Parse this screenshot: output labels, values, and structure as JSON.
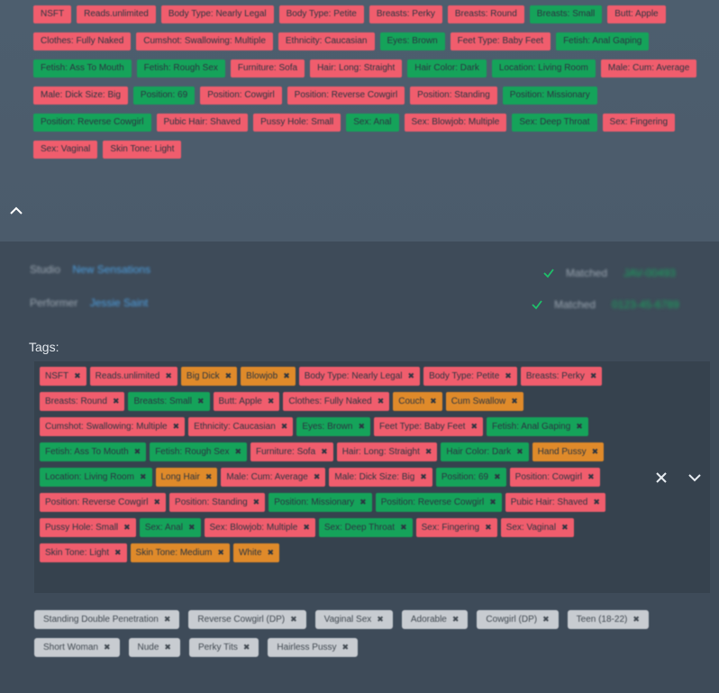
{
  "top_tags": [
    {
      "text": "NSFT",
      "color": "red"
    },
    {
      "text": "Reads.unlimited",
      "color": "red"
    },
    {
      "text": "Body Type: Nearly Legal",
      "color": "red"
    },
    {
      "text": "Body Type: Petite",
      "color": "red"
    },
    {
      "text": "Breasts: Perky",
      "color": "red"
    },
    {
      "text": "Breasts: Round",
      "color": "red"
    },
    {
      "text": "Breasts: Small",
      "color": "green"
    },
    {
      "text": "Butt: Apple",
      "color": "red"
    },
    {
      "text": "Clothes: Fully Naked",
      "color": "red"
    },
    {
      "text": "Cumshot: Swallowing: Multiple",
      "color": "red"
    },
    {
      "text": "Ethnicity: Caucasian",
      "color": "red"
    },
    {
      "text": "Eyes: Brown",
      "color": "green"
    },
    {
      "text": "Feet Type: Baby Feet",
      "color": "red"
    },
    {
      "text": "Fetish: Anal Gaping",
      "color": "green"
    },
    {
      "text": "Fetish: Ass To Mouth",
      "color": "green"
    },
    {
      "text": "Fetish: Rough Sex",
      "color": "green"
    },
    {
      "text": "Furniture: Sofa",
      "color": "red"
    },
    {
      "text": "Hair: Long: Straight",
      "color": "red"
    },
    {
      "text": "Hair Color: Dark",
      "color": "green"
    },
    {
      "text": "Location: Living Room",
      "color": "green"
    },
    {
      "text": "Male: Cum: Average",
      "color": "red"
    },
    {
      "text": "Male: Dick Size: Big",
      "color": "red"
    },
    {
      "text": "Position: 69",
      "color": "green"
    },
    {
      "text": "Position: Cowgirl",
      "color": "red"
    },
    {
      "text": "Position: Reverse Cowgirl",
      "color": "red"
    },
    {
      "text": "Position: Standing",
      "color": "red"
    },
    {
      "text": "Position: Missionary",
      "color": "green"
    },
    {
      "text": "Position: Reverse Cowgirl",
      "color": "green"
    },
    {
      "text": "Pubic Hair: Shaved",
      "color": "red"
    },
    {
      "text": "Pussy Hole: Small",
      "color": "red"
    },
    {
      "text": "Sex: Anal",
      "color": "green"
    },
    {
      "text": "Sex: Blowjob: Multiple",
      "color": "red"
    },
    {
      "text": "Sex: Deep Throat",
      "color": "green"
    },
    {
      "text": "Sex: Fingering",
      "color": "red"
    },
    {
      "text": "Sex: Vaginal",
      "color": "red"
    },
    {
      "text": "Skin Tone: Light",
      "color": "red"
    }
  ],
  "info": {
    "studio_key": "Studio",
    "studio_val": "New Sensations",
    "performer_key": "Performer",
    "performer_val": "Jessie Saint"
  },
  "status": [
    {
      "label": "Matched",
      "value": "JAV-00493"
    },
    {
      "label": "Matched",
      "value": "0123-45-6789"
    }
  ],
  "tags_label": "Tags:",
  "box_tags": [
    {
      "text": "NSFT",
      "color": "red"
    },
    {
      "text": "Reads.unlimited",
      "color": "red"
    },
    {
      "text": "Big Dick",
      "color": "orange"
    },
    {
      "text": "Blowjob",
      "color": "orange"
    },
    {
      "text": "Body Type: Nearly Legal",
      "color": "red"
    },
    {
      "text": "Body Type: Petite",
      "color": "red"
    },
    {
      "text": "Breasts: Perky",
      "color": "red"
    },
    {
      "text": "Breasts: Round",
      "color": "red"
    },
    {
      "text": "Breasts: Small",
      "color": "green"
    },
    {
      "text": "Butt: Apple",
      "color": "red"
    },
    {
      "text": "Clothes: Fully Naked",
      "color": "red"
    },
    {
      "text": "Couch",
      "color": "orange"
    },
    {
      "text": "Cum Swallow",
      "color": "orange"
    },
    {
      "text": "Cumshot: Swallowing: Multiple",
      "color": "red"
    },
    {
      "text": "Ethnicity: Caucasian",
      "color": "red"
    },
    {
      "text": "Eyes: Brown",
      "color": "green"
    },
    {
      "text": "Feet Type: Baby Feet",
      "color": "red"
    },
    {
      "text": "Fetish: Anal Gaping",
      "color": "green"
    },
    {
      "text": "Fetish: Ass To Mouth",
      "color": "green"
    },
    {
      "text": "Fetish: Rough Sex",
      "color": "green"
    },
    {
      "text": "Furniture: Sofa",
      "color": "red"
    },
    {
      "text": "Hair: Long: Straight",
      "color": "red"
    },
    {
      "text": "Hair Color: Dark",
      "color": "green"
    },
    {
      "text": "Hand Pussy",
      "color": "orange"
    },
    {
      "text": "Location: Living Room",
      "color": "green"
    },
    {
      "text": "Long Hair",
      "color": "orange"
    },
    {
      "text": "Male: Cum: Average",
      "color": "red"
    },
    {
      "text": "Male: Dick Size: Big",
      "color": "red"
    },
    {
      "text": "Position: 69",
      "color": "green"
    },
    {
      "text": "Position: Cowgirl",
      "color": "red"
    },
    {
      "text": "Position: Reverse Cowgirl",
      "color": "red"
    },
    {
      "text": "Position: Standing",
      "color": "red"
    },
    {
      "text": "Position: Missionary",
      "color": "green"
    },
    {
      "text": "Position: Reverse Cowgirl",
      "color": "green"
    },
    {
      "text": "Pubic Hair: Shaved",
      "color": "red"
    },
    {
      "text": "Pussy Hole: Small",
      "color": "red"
    },
    {
      "text": "Sex: Anal",
      "color": "green"
    },
    {
      "text": "Sex: Blowjob: Multiple",
      "color": "red"
    },
    {
      "text": "Sex: Deep Throat",
      "color": "green"
    },
    {
      "text": "Sex: Fingering",
      "color": "red"
    },
    {
      "text": "Sex: Vaginal",
      "color": "red"
    },
    {
      "text": "Skin Tone: Light",
      "color": "red"
    },
    {
      "text": "Skin Tone: Medium",
      "color": "orange"
    },
    {
      "text": "White",
      "color": "orange"
    }
  ],
  "suggested_tags": [
    {
      "text": "Standing Double Penetration",
      "color": "gray"
    },
    {
      "text": "Reverse Cowgirl (DP)",
      "color": "gray"
    },
    {
      "text": "Vaginal Sex",
      "color": "gray"
    },
    {
      "text": "Adorable",
      "color": "gray"
    },
    {
      "text": "Cowgirl (DP)",
      "color": "gray"
    },
    {
      "text": "Teen (18-22)",
      "color": "gray"
    },
    {
      "text": "Short Woman",
      "color": "gray"
    },
    {
      "text": "Nude",
      "color": "gray"
    },
    {
      "text": "Perky Tits",
      "color": "gray"
    },
    {
      "text": "Hairless Pussy",
      "color": "gray"
    }
  ],
  "colors": {
    "red": "#f05d6d",
    "green": "#15a35a",
    "orange": "#df8a2a",
    "gray": "#c8ccd1",
    "background": "#3e4b59",
    "top_panel": "#4d5e6e",
    "tag_box": "#36424e",
    "accent_blue": "#4d9fe0"
  },
  "icons": {
    "collapse": "chevron-up-icon",
    "check": "check-icon",
    "clear": "close-icon",
    "dropdown": "chevron-down-icon",
    "remove_tag": "close-icon"
  }
}
